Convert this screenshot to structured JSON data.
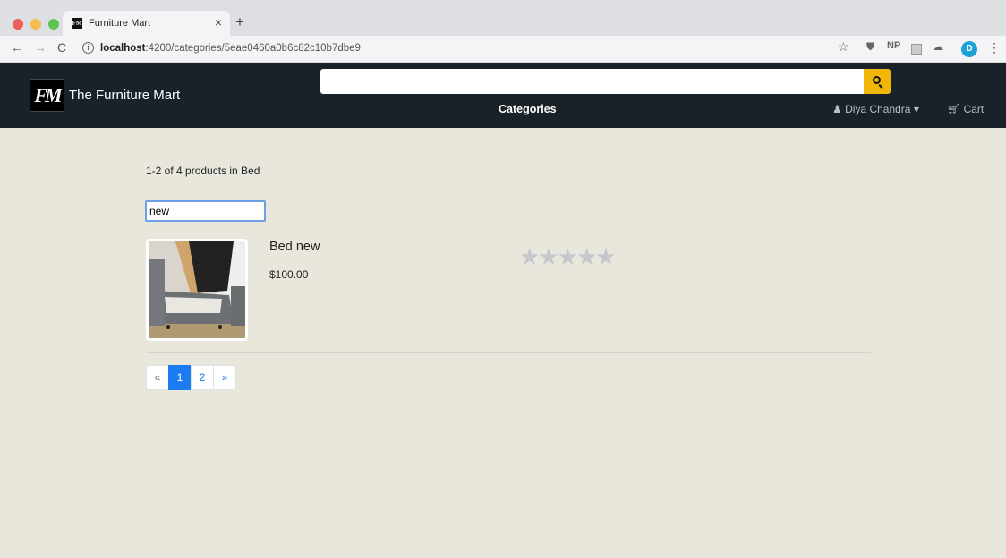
{
  "browser": {
    "tab_title": "Furniture Mart",
    "tab_favicon": "FM",
    "url_host": "localhost",
    "url_path": ":4200/categories/5eae0460a0b6c82c10b7dbe9",
    "extensions": [
      "star-icon",
      "shield-icon",
      "NP",
      "extension-icon",
      "cloud-icon"
    ],
    "ext_np": "NP",
    "profile_initial": "D"
  },
  "header": {
    "logo_text": "FM",
    "brand": "The Furniture Mart",
    "search_value": "",
    "categories_label": "Categories",
    "user_name": "Diya Chandra",
    "cart_label": "Cart",
    "accent_color": "#f2b706"
  },
  "main": {
    "summary": "1-2 of 4 products in Bed",
    "filter_value": "new",
    "products": [
      {
        "name": "Bed new",
        "price": "$100.00",
        "rating": 0,
        "max_rating": 5
      }
    ],
    "pagination": {
      "prev": "«",
      "pages": [
        "1",
        "2"
      ],
      "current": "1",
      "next": "»"
    }
  }
}
